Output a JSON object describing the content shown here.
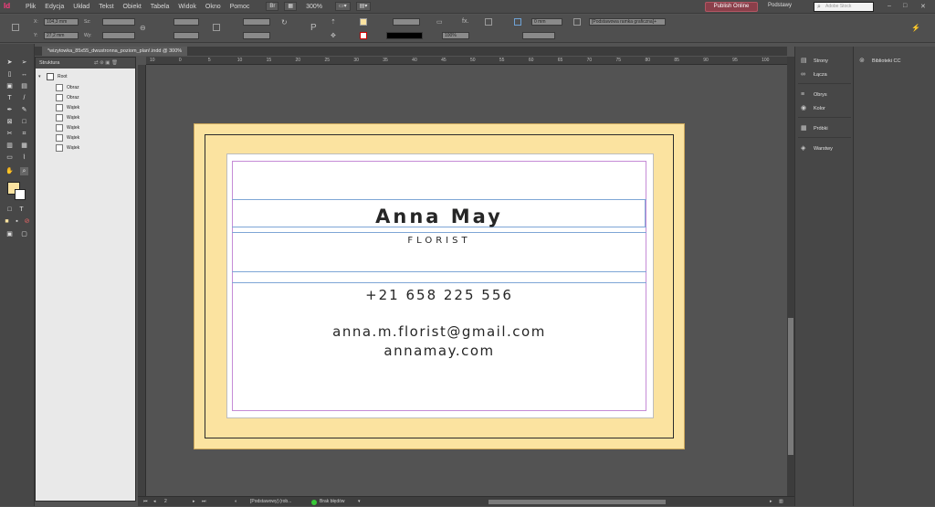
{
  "app": {
    "logo": "Id"
  },
  "menu": [
    "Plik",
    "Edycja",
    "Układ",
    "Tekst",
    "Obiekt",
    "Tabela",
    "Widok",
    "Okno",
    "Pomoc"
  ],
  "menubar": {
    "zoom": "300%",
    "publish_label": "Publish Online",
    "workspace": "Podstawy",
    "stock_placeholder": "Adobe Stock"
  },
  "control": {
    "x_label": "X:",
    "x_value": "104,3 mm",
    "y_label": "Y:",
    "y_value": "27,2 mm",
    "w_label": "Sz:",
    "h_label": "Wy:",
    "stroke_weight": "0 mm",
    "opacity": "100%",
    "frame_style": "[Podstawowa ramka graficzna]+"
  },
  "document": {
    "tab_title": "*wizytowka_85x55_dwustronna_poziom_plan!.indd @ 300%"
  },
  "ruler": {
    "h_ticks": [
      "10",
      "0",
      "5",
      "10",
      "15",
      "20",
      "25",
      "30",
      "35",
      "40",
      "45",
      "50",
      "55",
      "60",
      "65",
      "70",
      "75",
      "80",
      "85",
      "90",
      "95",
      "100"
    ]
  },
  "structure": {
    "title": "Struktura",
    "root": "Root",
    "items": [
      {
        "label": "Obraz",
        "type": "image"
      },
      {
        "label": "Obraz",
        "type": "image"
      },
      {
        "label": "Wątek",
        "type": "story"
      },
      {
        "label": "Wątek",
        "type": "story"
      },
      {
        "label": "Wątek",
        "type": "story"
      },
      {
        "label": "Wątek",
        "type": "story"
      },
      {
        "label": "Wątek",
        "type": "story"
      }
    ]
  },
  "card": {
    "name": "Anna May",
    "role": "FLORIST",
    "phone": "+21 658 225 556",
    "email": "anna.m.florist@gmail.com",
    "website": "annamay.com",
    "colors": {
      "bleed": "#fbe3a0",
      "margin_guide": "#c58bd6",
      "guide": "#7ea6d6"
    }
  },
  "panels": {
    "dock": [
      {
        "label": "Strony",
        "icon": "pages-icon"
      },
      {
        "label": "Łącza",
        "icon": "links-icon"
      },
      {
        "label": "Obrys",
        "icon": "stroke-icon"
      },
      {
        "label": "Kolor",
        "icon": "color-icon"
      },
      {
        "label": "Próbki",
        "icon": "swatches-icon"
      },
      {
        "label": "Warstwy",
        "icon": "layers-icon"
      }
    ],
    "libraries": "Biblioteki CC"
  },
  "status": {
    "page": "2",
    "master": "[Podstawowy] (rob...",
    "preflight": "Brak błędów"
  }
}
